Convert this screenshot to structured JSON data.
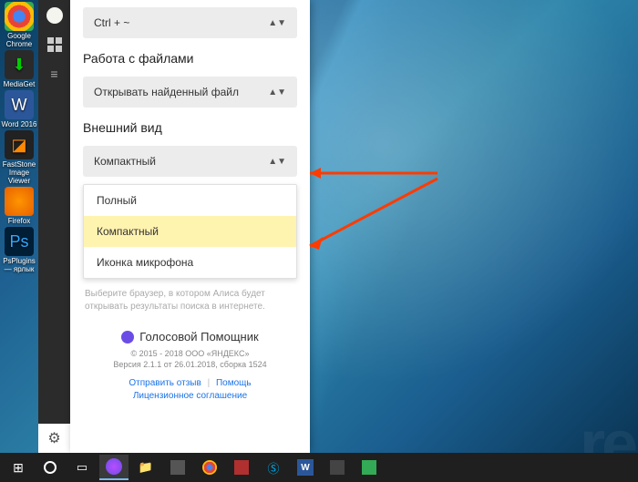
{
  "desktop_icons": [
    {
      "name": "chrome",
      "label": "Google Chrome",
      "cls": "chrome"
    },
    {
      "name": "mediaget",
      "label": "MediaGet",
      "cls": "mediag",
      "glyph": "⬇"
    },
    {
      "name": "word",
      "label": "Word 2016",
      "cls": "word",
      "glyph": "W"
    },
    {
      "name": "faststone",
      "label": "FastStone Image Viewer",
      "cls": "faststone",
      "glyph": "◪"
    },
    {
      "name": "firefox",
      "label": "Firefox",
      "cls": "firefox"
    },
    {
      "name": "psplugins",
      "label": "PsPlugins — ярлык",
      "cls": "ps",
      "glyph": "Ps"
    }
  ],
  "panel": {
    "hotkey_value": "Ctrl + ~",
    "files_section_title": "Работа с файлами",
    "files_dropdown_value": "Открывать найденный файл",
    "appearance_section_title": "Внешний вид",
    "appearance_dropdown_value": "Компактный",
    "appearance_options": {
      "full": "Полный",
      "compact": "Компактный",
      "mic_icon": "Иконка микрофона"
    },
    "muted_text": "Выберите браузер, в котором Алиса будет открывать результаты поиска в интернете.",
    "footer": {
      "title": "Голосовой Помощник",
      "copyright": "© 2015 - 2018 ООО «ЯНДЕКС»",
      "version": "Версия 2.1.1 от 26.01.2018, сборка 1524",
      "link_feedback": "Отправить отзыв",
      "link_help": "Помощь",
      "link_license": "Лицензионное соглашение"
    }
  },
  "taskbar": {}
}
